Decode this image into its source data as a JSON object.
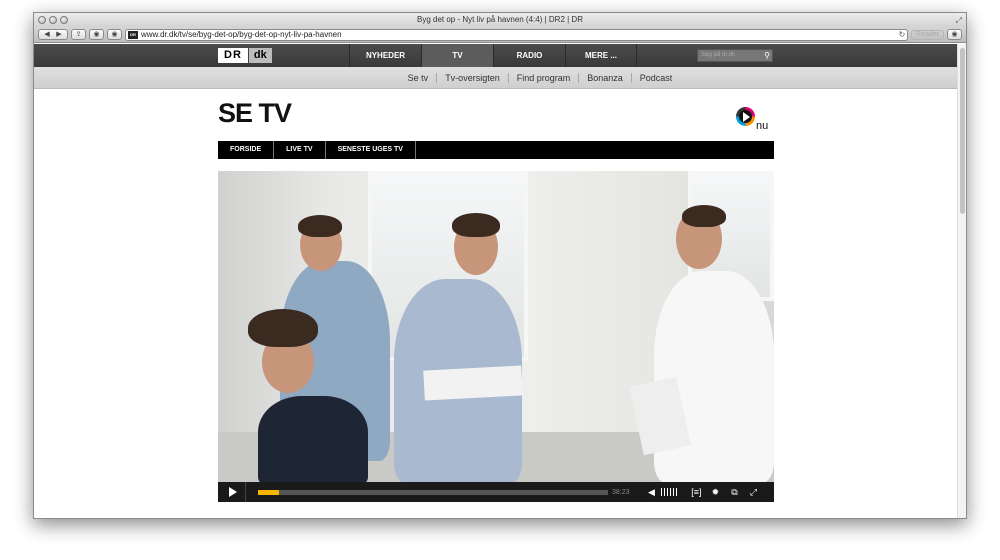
{
  "browser": {
    "title": "Byg det op - Nyt liv på havnen (4:4) | DR2 | DR",
    "url": "www.dr.dk/tv/se/byg-det-op/byg-det-op-nyt-liv-pa-havnen",
    "reader_label": "Reader",
    "favicon_text": "DR"
  },
  "dr_header": {
    "logo_dr": "DR",
    "logo_dk": "dk",
    "nav": [
      "NYHEDER",
      "TV",
      "RADIO",
      "MERE ..."
    ],
    "active_nav": "TV",
    "search_placeholder": "Søg på dr.dk",
    "sub_nav": [
      "Se tv",
      "Tv-oversigten",
      "Find program",
      "Bonanza",
      "Podcast"
    ]
  },
  "page": {
    "title": "SE TV",
    "nu_logo_text": "nu",
    "tabs": [
      "FORSIDE",
      "LIVE TV",
      "SENESTE UGES TV"
    ]
  },
  "player": {
    "duration": "38:23",
    "progress_fraction": 0.06
  },
  "colors": {
    "progress": "#f5b400",
    "header_dark": "#3a3a3a",
    "tab_bar": "#000000"
  }
}
